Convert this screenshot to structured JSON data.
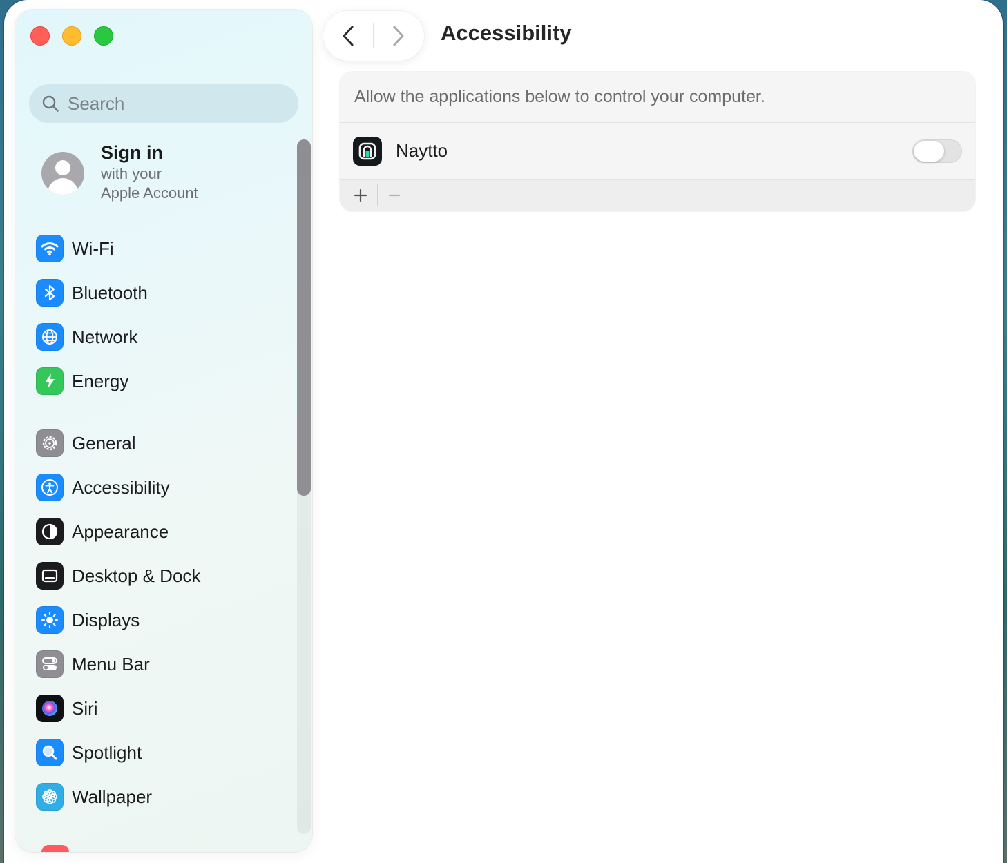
{
  "window": {
    "title": "Accessibility"
  },
  "search": {
    "placeholder": "Search"
  },
  "account": {
    "title": "Sign in",
    "subtitle_line1": "with your",
    "subtitle_line2": "Apple Account"
  },
  "sidebar": {
    "group1": [
      {
        "label": "Wi-Fi",
        "icon": "wifi-icon",
        "color": "#1a8cff"
      },
      {
        "label": "Bluetooth",
        "icon": "bluetooth-icon",
        "color": "#1a8cff"
      },
      {
        "label": "Network",
        "icon": "globe-icon",
        "color": "#1a8cff"
      },
      {
        "label": "Energy",
        "icon": "bolt-icon",
        "color": "#34c759"
      }
    ],
    "group2": [
      {
        "label": "General",
        "icon": "gear-icon",
        "color": "#8e8e93"
      },
      {
        "label": "Accessibility",
        "icon": "accessibility-icon",
        "color": "#1a8cff"
      },
      {
        "label": "Appearance",
        "icon": "appearance-icon",
        "color": "#1c1c1e"
      },
      {
        "label": "Desktop & Dock",
        "icon": "dock-icon",
        "color": "#1c1c1e"
      },
      {
        "label": "Displays",
        "icon": "sun-icon",
        "color": "#1a8cff"
      },
      {
        "label": "Menu Bar",
        "icon": "toggles-icon",
        "color": "#8e8e93"
      },
      {
        "label": "Siri",
        "icon": "siri-icon",
        "color": "#5e5ce6"
      },
      {
        "label": "Spotlight",
        "icon": "magnifier-icon",
        "color": "#1a8cff"
      },
      {
        "label": "Wallpaper",
        "icon": "flower-icon",
        "color": "#32ade6"
      }
    ]
  },
  "content": {
    "description": "Allow the applications below to control your computer.",
    "apps": [
      {
        "name": "Naytto",
        "enabled": false
      }
    ],
    "add_symbol": "+",
    "remove_symbol": "−"
  },
  "colors": {
    "accent": "#1a8cff",
    "traffic_close": "#ff5f57",
    "traffic_minimize": "#febc2e",
    "traffic_maximize": "#28c840"
  }
}
